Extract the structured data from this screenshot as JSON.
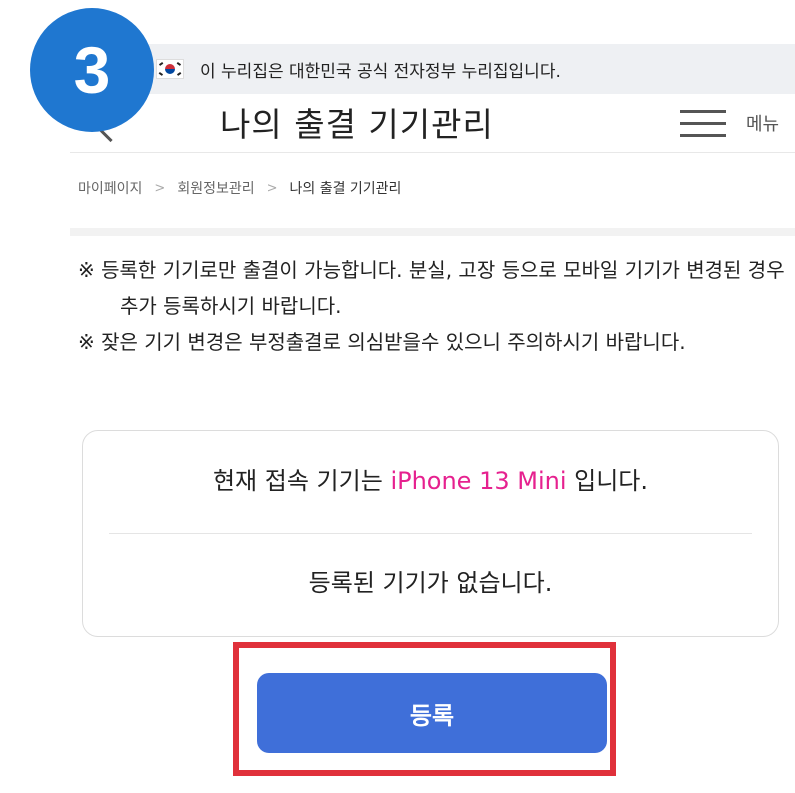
{
  "step_badge": "3",
  "gov_banner": {
    "text": "이 누리집은 대한민국 공식 전자정부 누리집입니다."
  },
  "header": {
    "title": "나의 출결 기기관리",
    "menu_label": "메뉴"
  },
  "breadcrumb": {
    "items": [
      "마이페이지",
      "회원정보관리",
      "나의 출결 기기관리"
    ],
    "separator": ">"
  },
  "notice": {
    "items": [
      "※ 등록한 기기로만 출결이 가능합니다. 분실, 고장 등으로 모바일 기기가 변경된 경우 추가 등록하시기 바랍니다.",
      "※ 잦은 기기 변경은 부정출결로 의심받을수 있으니 주의하시기 바랍니다."
    ]
  },
  "device_box": {
    "current_prefix": "현재 접속 기기는",
    "device_name": "iPhone 13 Mini",
    "current_suffix": "입니다.",
    "registered_status": "등록된 기기가 없습니다."
  },
  "register_button_label": "등록",
  "colors": {
    "badge": "#1f77d0",
    "device_highlight": "#e6218f",
    "button": "#3f6fd9",
    "highlight_frame": "#e0313b"
  }
}
